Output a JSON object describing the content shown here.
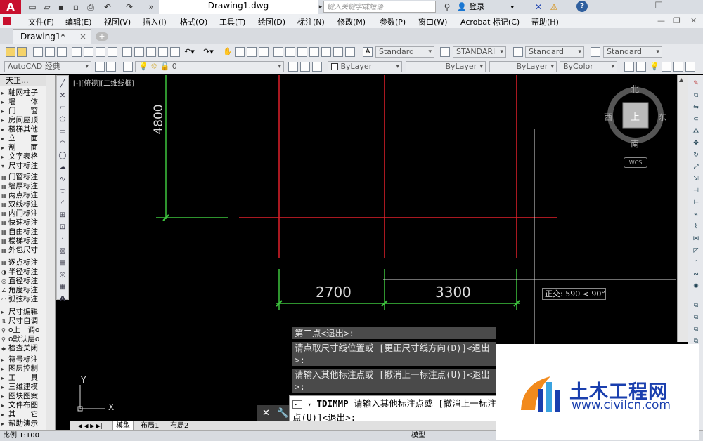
{
  "titlebar": {
    "app_logo": "A",
    "doc_title": "Drawing1.dwg",
    "search_placeholder": "键入关键字或短语",
    "login_label": "登录",
    "help": "?",
    "minimize": "—",
    "maximize": "☐"
  },
  "menubar": {
    "items": [
      "文件(F)",
      "编辑(E)",
      "视图(V)",
      "插入(I)",
      "格式(O)",
      "工具(T)",
      "绘图(D)",
      "标注(N)",
      "修改(M)",
      "参数(P)",
      "窗口(W)",
      "Acrobat 标记(C)",
      "帮助(H)"
    ]
  },
  "tabs": {
    "active": "Drawing1*",
    "close": "×",
    "new": "+"
  },
  "toolbar1": {
    "text_style": "Standard",
    "dim_style": "STANDARI",
    "table_style": "Standard",
    "mleader_style": "Standard"
  },
  "toolbar2": {
    "workspace": "AutoCAD 经典",
    "layer": "0",
    "color": "ByLayer",
    "linetype": "ByLayer",
    "lineweight": "ByLayer",
    "plotstyle": "ByColor"
  },
  "leftpanel": {
    "header": "天正...",
    "items": [
      "轴网柱子",
      "墙　　体",
      "门　　窗",
      "房间屋顶",
      "楼梯其他",
      "立　　面",
      "剖　　面",
      "文字表格",
      "尺寸标注",
      "门窗标注",
      "墙厚标注",
      "两点标注",
      "双线标注",
      "内门标注",
      "快速标注",
      "自由标注",
      "楼梯标注",
      "外包尺寸",
      "逐点标注",
      "半径标注",
      "直径标注",
      "角度标注",
      "弧弦标注",
      "尺寸编辑",
      "尺寸自调",
      "o上　调o",
      "o默认层o",
      "检查关闭",
      "符号标注",
      "图层控制",
      "工　　具",
      "三维建模",
      "图块图案",
      "文件布图",
      "其　　它",
      "帮助演示"
    ]
  },
  "canvas": {
    "viewport_label": "[-][俯视][二维线框]",
    "dim_vertical": "4800",
    "dim_left": "2700",
    "dim_right": "3300",
    "ucs_y": "Y",
    "ucs_x": "X",
    "compass": {
      "north": "北",
      "south": "南",
      "east": "东",
      "west": "西",
      "top": "上",
      "wcs": "WCS"
    },
    "ortho_tooltip": "正交: 590 < 90°"
  },
  "command": {
    "history": [
      "第二点<退出>:",
      "请点取尺寸线位置或 [更正尺寸线方向(D)]<退出>:",
      "请输入其他标注点或 [撤消上一标注点(U)]<退出>:"
    ],
    "close_icon": "✕",
    "wrench_icon": "wrench-icon",
    "prompt_cmd": "TDIMMP",
    "prompt_text": "请输入其他标注点或 [撤消上一标注点(U)]<退出>:"
  },
  "layouts": {
    "tabs": [
      "模型",
      "布局1",
      "布局2"
    ]
  },
  "statusbar": {
    "scale": "比例 1:100",
    "model": "模型"
  },
  "watermark": {
    "brand": "土木工程网",
    "url": "www.civilcn.com"
  }
}
